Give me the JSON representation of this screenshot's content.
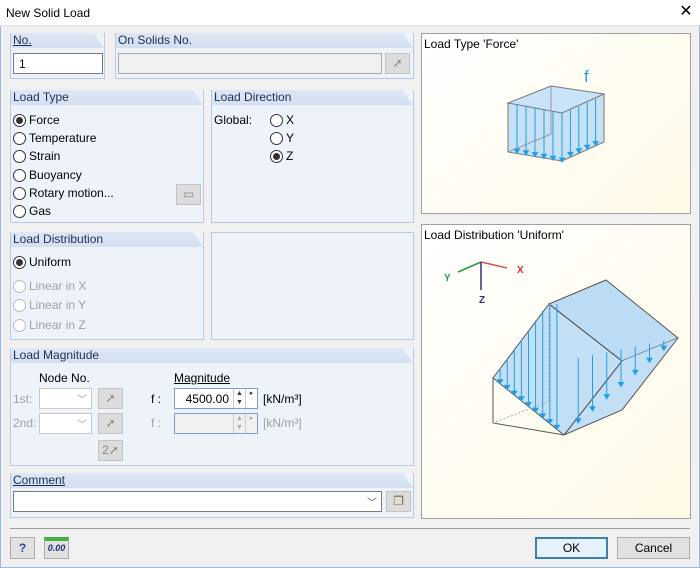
{
  "window": {
    "title": "New Solid Load",
    "close_icon": "close-icon"
  },
  "no": {
    "label": "No.",
    "value": "1"
  },
  "on_solids": {
    "label": "On Solids No.",
    "value": ""
  },
  "load_type": {
    "label": "Load Type",
    "options": [
      "Force",
      "Temperature",
      "Strain",
      "Buoyancy",
      "Rotary motion...",
      "Gas"
    ],
    "selected": "Force"
  },
  "load_direction": {
    "label": "Load Direction",
    "global_label": "Global:",
    "options": [
      "X",
      "Y",
      "Z"
    ],
    "selected": "Z"
  },
  "load_distribution": {
    "label": "Load Distribution",
    "options": [
      "Uniform",
      "Linear in X",
      "Linear in Y",
      "Linear in Z"
    ],
    "selected": "Uniform"
  },
  "load_magnitude": {
    "label": "Load Magnitude",
    "node_no_label": "Node No.",
    "magnitude_label": "Magnitude",
    "row1_label": "1st:",
    "row2_label": "2nd:",
    "f1_label": "f :",
    "f2_label": "f :",
    "f1_value": "4500.00",
    "f2_value": "",
    "unit1": "[kN/m³]",
    "unit2": "[kN/m³]"
  },
  "comment": {
    "label": "Comment",
    "value": ""
  },
  "preview": {
    "load_type_title": "Load Type 'Force'",
    "force_symbol": "f",
    "distribution_title": "Load Distribution 'Uniform'",
    "axis_x": "X",
    "axis_y": "Y",
    "axis_z": "Z"
  },
  "buttons": {
    "ok": "OK",
    "cancel": "Cancel",
    "units_label": "0.00"
  },
  "colors": {
    "header": "#dde7f5",
    "load": "#1ea0e6",
    "fill": "#bcdcf5"
  }
}
